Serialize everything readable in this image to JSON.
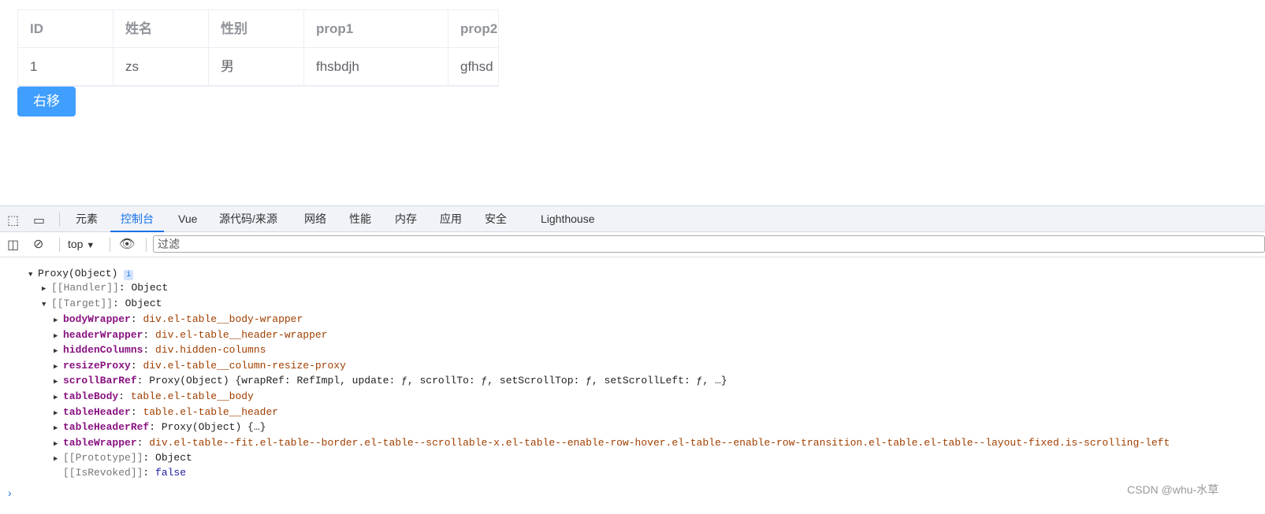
{
  "table": {
    "headers": [
      "ID",
      "姓名",
      "性别",
      "prop1",
      "prop2"
    ],
    "rows": [
      [
        "1",
        "zs",
        "男",
        "fhsbdjh",
        "gfhsd"
      ]
    ]
  },
  "button": {
    "label": "右移"
  },
  "devtools": {
    "tabs": [
      "元素",
      "控制台",
      "Vue",
      "源代码/来源",
      "网络",
      "性能",
      "内存",
      "应用",
      "安全",
      "Lighthouse"
    ],
    "active_tab": "控制台",
    "context": "top",
    "filter_placeholder": "过滤",
    "accent": "#1a73e8"
  },
  "console": {
    "root": "Proxy(Object)",
    "root_badge": "i",
    "handler": {
      "key": "[[Handler]]",
      "value": "Object"
    },
    "target": {
      "key": "[[Target]]",
      "value": "Object"
    },
    "props": [
      {
        "key": "bodyWrapper",
        "value": "div.el-table__body-wrapper"
      },
      {
        "key": "headerWrapper",
        "value": "div.el-table__header-wrapper"
      },
      {
        "key": "hiddenColumns",
        "value": "div.hidden-columns"
      },
      {
        "key": "resizeProxy",
        "value": "div.el-table__column-resize-proxy"
      },
      {
        "key": "scrollBarRef",
        "value": "Proxy(Object) {wrapRef: RefImpl, update: ƒ, scrollTo: ƒ, setScrollTop: ƒ, setScrollLeft: ƒ, …}"
      },
      {
        "key": "tableBody",
        "value": "table.el-table__body"
      },
      {
        "key": "tableHeader",
        "value": "table.el-table__header"
      },
      {
        "key": "tableHeaderRef",
        "value": "Proxy(Object) {…}"
      },
      {
        "key": "tableWrapper",
        "value": "div.el-table--fit.el-table--border.el-table--scrollable-x.el-table--enable-row-hover.el-table--enable-row-transition.el-table.el-table--layout-fixed.is-scrolling-left"
      }
    ],
    "prototype": {
      "key": "[[Prototype]]",
      "value": "Object"
    },
    "revoked": {
      "key": "[[IsRevoked]]",
      "value": "false"
    }
  },
  "watermark": "CSDN @whu-水草"
}
